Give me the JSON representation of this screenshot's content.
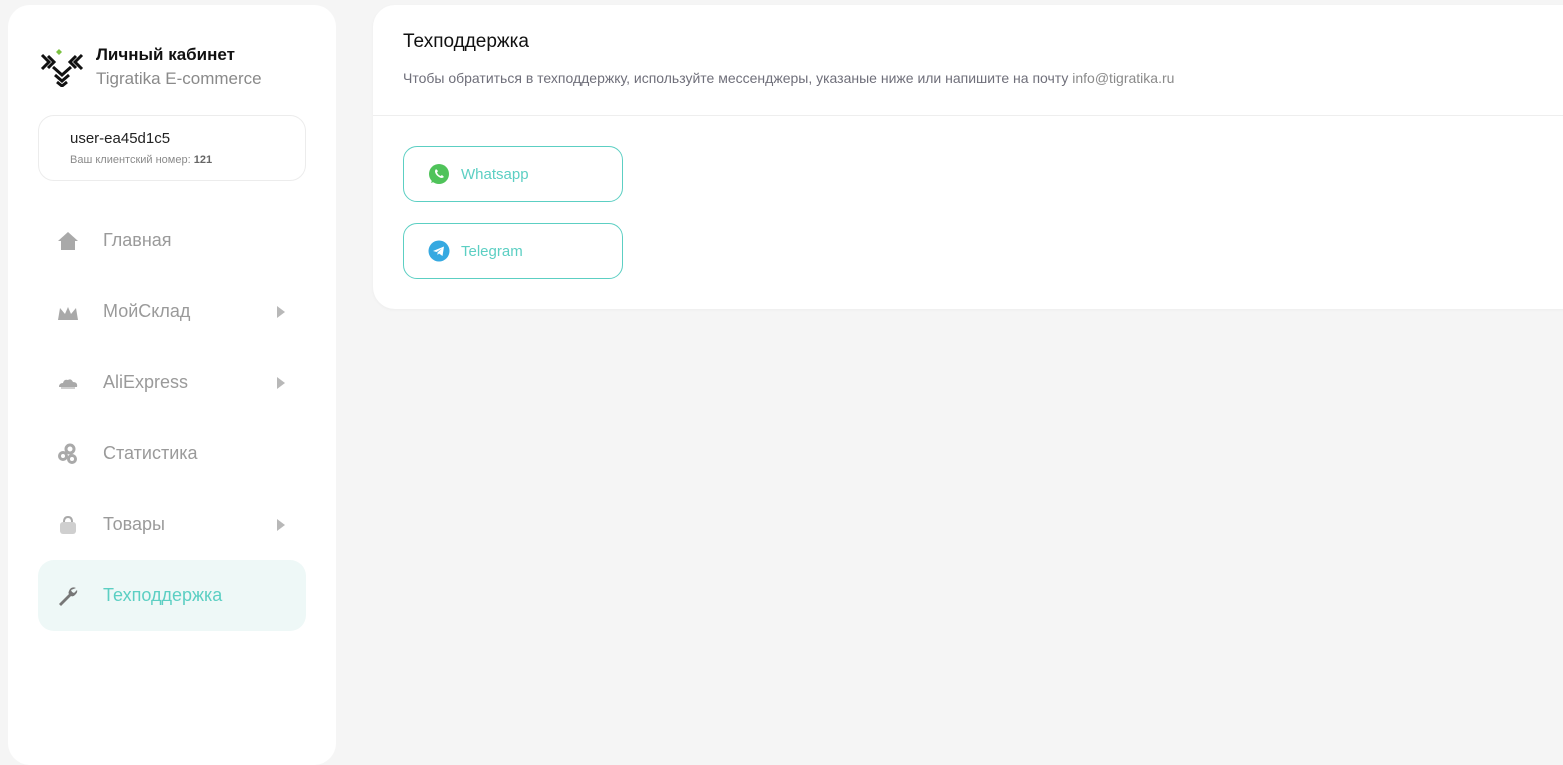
{
  "brand": {
    "title": "Личный кабинет",
    "subtitle": "Tigratika E-commerce"
  },
  "user": {
    "name": "user-ea45d1c5",
    "client_number_label": "Ваш клиентский номер:",
    "client_number": "121"
  },
  "sidebar": {
    "items": [
      {
        "label": "Главная",
        "icon": "home-icon",
        "has_arrow": false,
        "active": false
      },
      {
        "label": "МойСклад",
        "icon": "warehouse-icon",
        "has_arrow": true,
        "active": false
      },
      {
        "label": "AliExpress",
        "icon": "cloud-icon",
        "has_arrow": true,
        "active": false
      },
      {
        "label": "Статистика",
        "icon": "gears-icon",
        "has_arrow": false,
        "active": false
      },
      {
        "label": "Товары",
        "icon": "bag-icon",
        "has_arrow": true,
        "active": false
      },
      {
        "label": "Техподдержка",
        "icon": "wrench-icon",
        "has_arrow": false,
        "active": true
      }
    ]
  },
  "main": {
    "title": "Техподдержка",
    "description": "Чтобы обратиться в техподдержку, используйте мессенджеры, указаные ниже или напишите на почту",
    "email": "info@tigratika.ru",
    "buttons": [
      {
        "label": "Whatsapp",
        "icon": "whatsapp-icon",
        "color": "#4fc35a"
      },
      {
        "label": "Telegram",
        "icon": "telegram-icon",
        "color": "#36a9e1"
      }
    ]
  },
  "colors": {
    "accent": "#5ccfc3",
    "active_bg": "#eef8f7",
    "page_bg": "#f5f5f5"
  }
}
